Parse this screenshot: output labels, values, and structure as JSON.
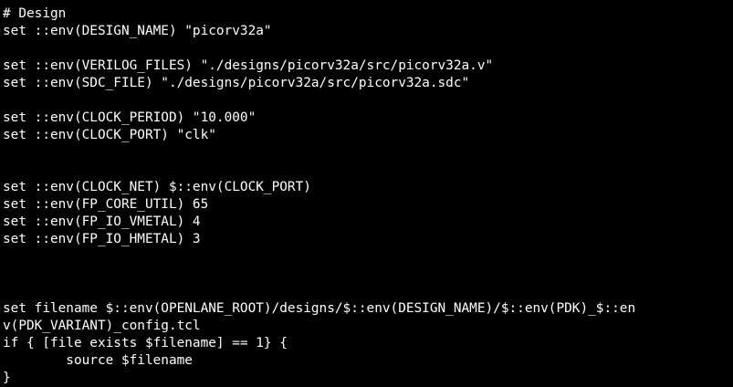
{
  "terminal": {
    "background": "#000000",
    "foreground": "#ffffff",
    "lines": [
      "# Design",
      "set ::env(DESIGN_NAME) \"picorv32a\"",
      "",
      "set ::env(VERILOG_FILES) \"./designs/picorv32a/src/picorv32a.v\"",
      "set ::env(SDC_FILE) \"./designs/picorv32a/src/picorv32a.sdc\"",
      "",
      "set ::env(CLOCK_PERIOD) \"10.000\"",
      "set ::env(CLOCK_PORT) \"clk\"",
      "",
      "",
      "set ::env(CLOCK_NET) $::env(CLOCK_PORT)",
      "set ::env(FP_CORE_UTIL) 65",
      "set ::env(FP_IO_VMETAL) 4",
      "set ::env(FP_IO_HMETAL) 3",
      "",
      "",
      "",
      "set filename $::env(OPENLANE_ROOT)/designs/$::env(DESIGN_NAME)/$::env(PDK)_$::en",
      "v(PDK_VARIANT)_config.tcl",
      "if { [file exists $filename] == 1} {",
      "        source $filename",
      "}"
    ]
  }
}
